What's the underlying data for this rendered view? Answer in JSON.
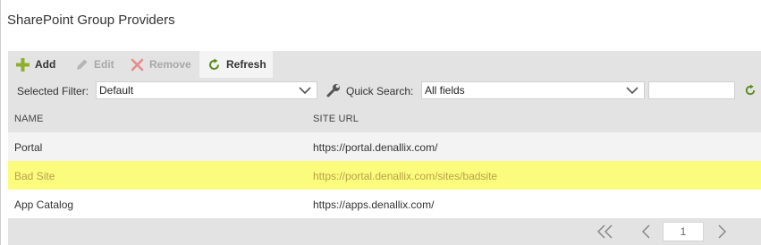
{
  "page": {
    "title": "SharePoint Group Providers"
  },
  "toolbar": {
    "add_label": "Add",
    "edit_label": "Edit",
    "remove_label": "Remove",
    "refresh_label": "Refresh",
    "add_icon": "plus-icon",
    "edit_icon": "pencil-icon",
    "remove_icon": "x-icon",
    "refresh_icon": "refresh-icon"
  },
  "filter": {
    "selected_filter_label": "Selected Filter:",
    "selected_filter_value": "Default",
    "quick_search_label": "Quick Search:",
    "quick_search_scope": "All fields",
    "search_text": "",
    "wrench_icon": "wrench-icon"
  },
  "table": {
    "columns": [
      "NAME",
      "SITE URL"
    ],
    "rows": [
      {
        "name": "Portal",
        "url": "https://portal.denallix.com/"
      },
      {
        "name": "Bad Site",
        "url": "https://portal.denallix.com/sites/badsite",
        "highlighted": true
      },
      {
        "name": "App Catalog",
        "url": "https://apps.denallix.com/"
      }
    ]
  },
  "pager": {
    "page": "1"
  },
  "colors": {
    "add_icon": "#8fae2c",
    "remove_icon": "#e58b8b",
    "refresh_icon": "#5d8a1e",
    "highlight_row": "#fbfb7d"
  }
}
